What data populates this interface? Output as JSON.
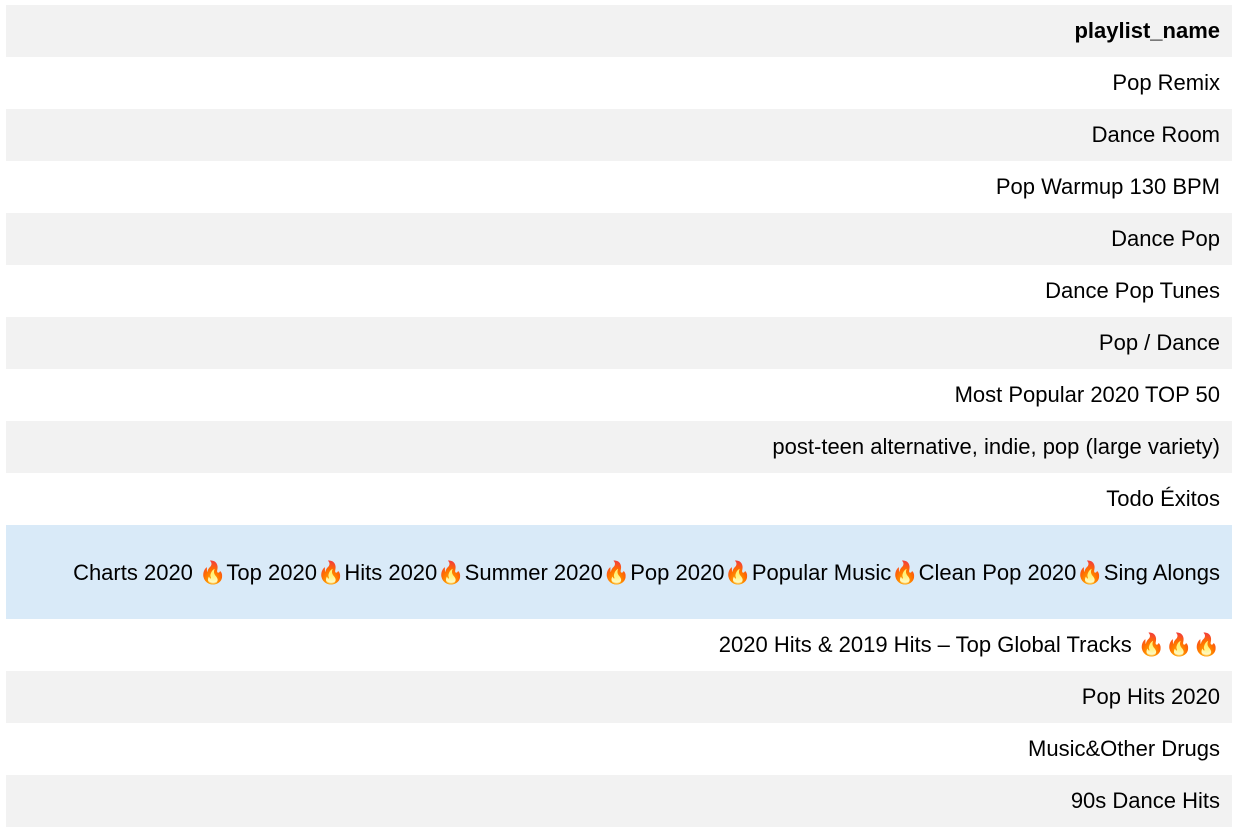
{
  "table": {
    "header": "playlist_name",
    "rows": [
      {
        "label": "Pop Remix"
      },
      {
        "label": "Dance Room"
      },
      {
        "label": "Pop Warmup 130 BPM"
      },
      {
        "label": "Dance Pop"
      },
      {
        "label": "Dance Pop Tunes"
      },
      {
        "label": "Pop / Dance"
      },
      {
        "label": "Most Popular 2020 TOP 50"
      },
      {
        "label": "post-teen alternative, indie, pop (large variety)"
      },
      {
        "label": "Todo Éxitos"
      },
      {
        "label": "Charts 2020 🔥Top 2020🔥Hits 2020🔥Summer 2020🔥Pop 2020🔥Popular Music🔥Clean Pop 2020🔥Sing Alongs"
      },
      {
        "label": "2020 Hits & 2019 Hits – Top Global Tracks 🔥🔥🔥"
      },
      {
        "label": "Pop Hits 2020"
      },
      {
        "label": "Music&Other Drugs"
      },
      {
        "label": "90s Dance Hits"
      }
    ],
    "highlighted_row_index": 9,
    "colors": {
      "header_bg": "#f2f2f2",
      "odd_row_bg": "#f2f2f2",
      "even_row_bg": "#ffffff",
      "highlight_bg": "#d9eaf8"
    }
  }
}
